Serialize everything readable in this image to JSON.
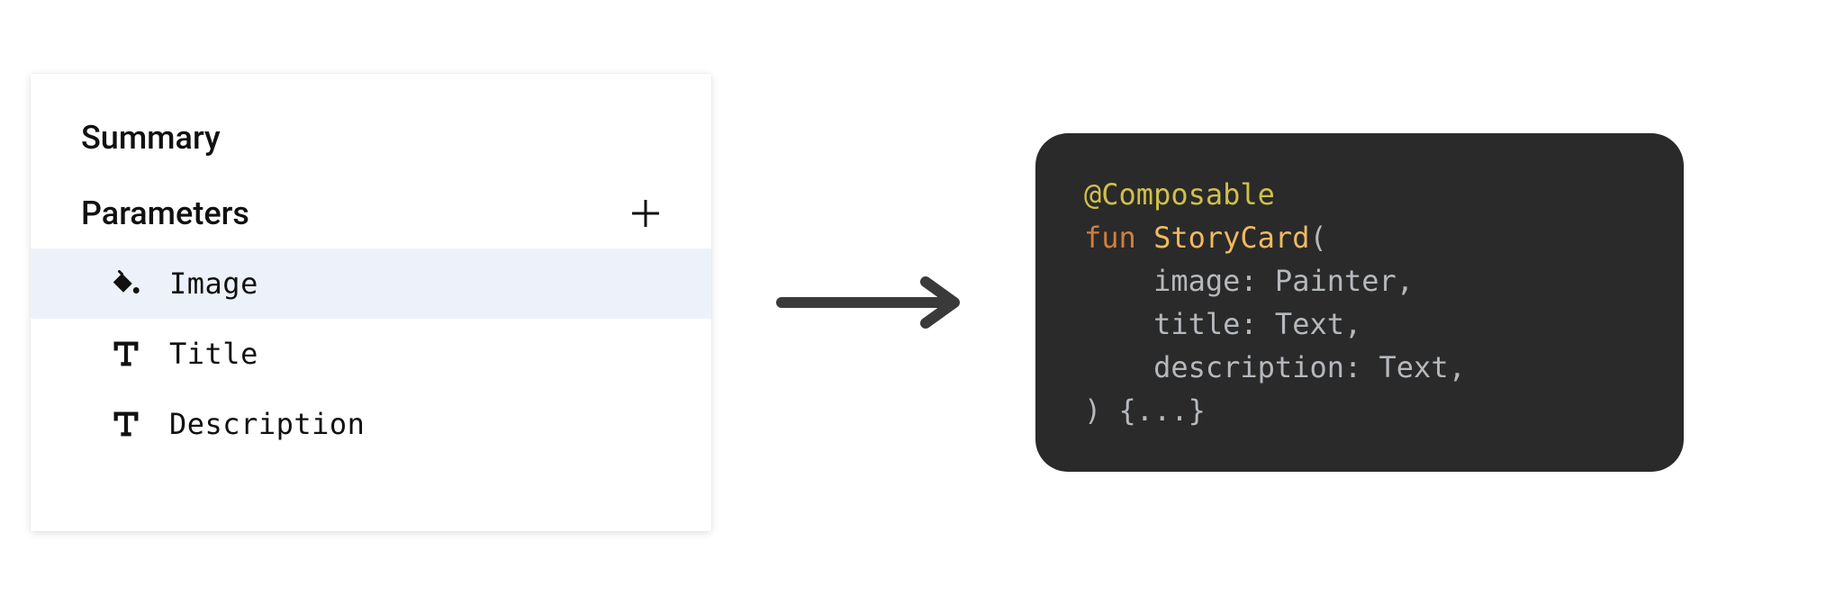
{
  "panel": {
    "summary_label": "Summary",
    "parameters_label": "Parameters",
    "items": [
      {
        "label": "Image",
        "icon": "paint",
        "selected": true
      },
      {
        "label": "Title",
        "icon": "text",
        "selected": false
      },
      {
        "label": "Description",
        "icon": "text",
        "selected": false
      }
    ]
  },
  "code": {
    "annotation": "@Composable",
    "keyword_fun": "fun",
    "func_name": "StoryCard",
    "open_paren": "(",
    "params": [
      {
        "name": "image",
        "type": "Painter"
      },
      {
        "name": "title",
        "type": "Text"
      },
      {
        "name": "description",
        "type": "Text"
      }
    ],
    "close": ") {...}"
  }
}
